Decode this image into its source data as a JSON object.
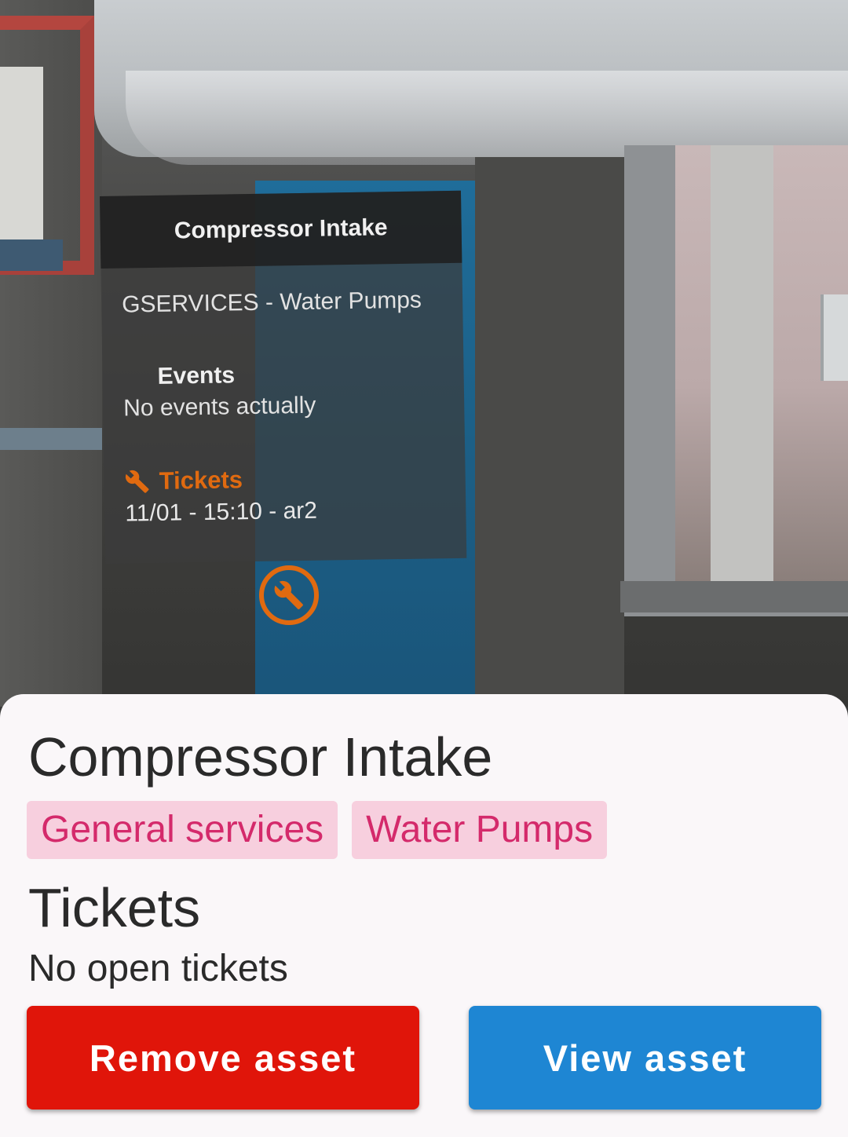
{
  "ar_overlay": {
    "title": "Compressor Intake",
    "subtitle": "GSERVICES - Water Pumps",
    "events_title": "Events",
    "events_text": "No events actually",
    "tickets_title": "Tickets",
    "tickets_text": "11/01 - 15:10 - ar2",
    "accent_color": "#e06a10",
    "icon": "wrench-icon"
  },
  "sheet": {
    "title": "Compressor Intake",
    "chips": [
      "General services",
      "Water Pumps"
    ],
    "tickets_heading": "Tickets",
    "tickets_status": "No open tickets",
    "remove_label": "Remove asset",
    "view_label": "View asset",
    "chip_bg": "#f7cfde",
    "chip_text": "#d42a6b",
    "remove_color": "#e0150a",
    "view_color": "#1e86d3"
  }
}
